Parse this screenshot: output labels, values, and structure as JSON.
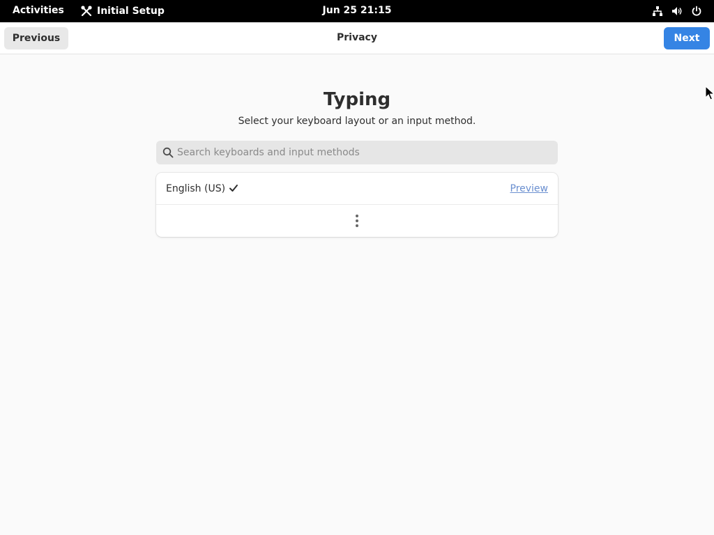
{
  "topbar": {
    "activities": "Activities",
    "app_name": "Initial Setup",
    "clock": "Jun 25  21:15",
    "tray_icons": [
      "network-icon",
      "volume-icon",
      "power-icon"
    ]
  },
  "headerbar": {
    "previous_label": "Previous",
    "title": "Privacy",
    "next_label": "Next"
  },
  "page": {
    "title": "Typing",
    "subtitle": "Select your keyboard layout or an input method."
  },
  "search": {
    "placeholder": "Search keyboards and input methods",
    "value": ""
  },
  "layouts": [
    {
      "name": "English (US)",
      "selected": true,
      "preview_label": "Preview"
    }
  ],
  "colors": {
    "accent": "#3584e4",
    "link": "#6a8fd0",
    "topbar_bg": "#000000",
    "page_bg": "#fafafa"
  }
}
